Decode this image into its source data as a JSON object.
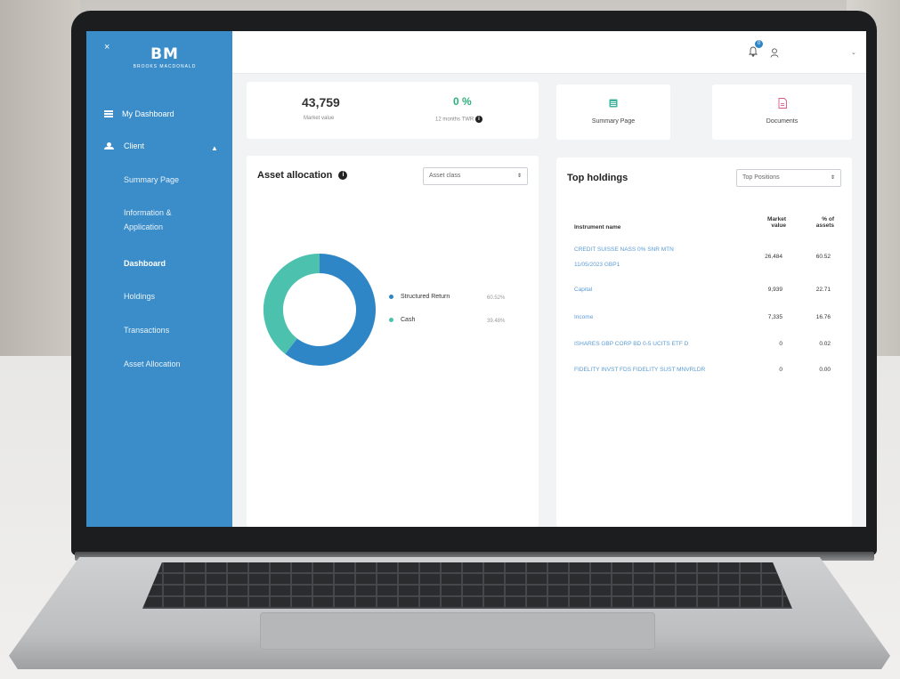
{
  "brand": {
    "mark": "BM",
    "name": "BROOKS MACDONALD"
  },
  "colors": {
    "sidebar": "#3a8dc8",
    "structured_return": "#2f86c6",
    "cash": "#4cc1ae",
    "positive": "#2bb07a",
    "link": "#5b9bd5"
  },
  "sidebar": {
    "close": "×",
    "dashboard": "My Dashboard",
    "client": "Client",
    "items": [
      {
        "label": "Summary Page",
        "active": false
      },
      {
        "label": "Information &",
        "label2": "Application",
        "active": false
      },
      {
        "label": "Dashboard",
        "active": true
      },
      {
        "label": "Holdings",
        "active": false
      },
      {
        "label": "Transactions",
        "active": false
      },
      {
        "label": "Asset Allocation",
        "active": false
      }
    ]
  },
  "topbar": {
    "notification_count": "0",
    "caret": "⌄"
  },
  "kpis": {
    "market_value": {
      "value": "43,759",
      "label": "Market value"
    },
    "twr": {
      "value": "0 %",
      "label": "12 months TWR"
    }
  },
  "tiles": {
    "summary": "Summary Page",
    "documents": "Documents"
  },
  "asset_allocation": {
    "title": "Asset allocation",
    "selector": "Asset class",
    "legend": [
      {
        "name": "Structured Return",
        "pct": "60.52%",
        "value": 60.52
      },
      {
        "name": "Cash",
        "pct": "39.48%",
        "value": 39.48
      }
    ]
  },
  "top_holdings": {
    "title": "Top holdings",
    "selector": "Top Positions",
    "headers": {
      "name": "Instrument name",
      "mv1": "Market",
      "mv2": "value",
      "pct1": "% of",
      "pct2": "assets"
    },
    "rows": [
      {
        "name": "CREDIT SUISSE NASS 0% SNR MTN",
        "name2": "11/05/2023 GBP1",
        "mv": "26,484",
        "pct": "60.52"
      },
      {
        "name": "Capital",
        "name2": "",
        "mv": "9,939",
        "pct": "22.71"
      },
      {
        "name": "Income",
        "name2": "",
        "mv": "7,335",
        "pct": "16.76"
      },
      {
        "name": "ISHARES GBP CORP BD 0-5 UCITS ETF D",
        "name2": "",
        "mv": "0",
        "pct": "0.02"
      },
      {
        "name": "FIDELITY INVST FDS FIDELITY SUST MNVRLDR",
        "name2": "",
        "mv": "0",
        "pct": "0.00"
      }
    ]
  }
}
